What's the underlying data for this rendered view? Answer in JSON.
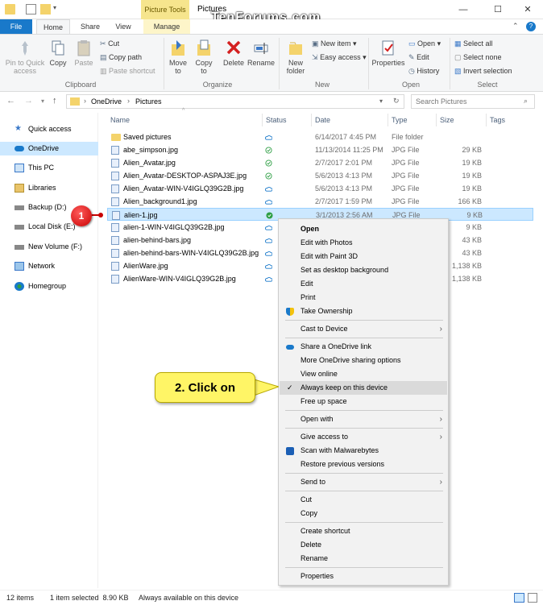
{
  "window": {
    "title": "Pictures",
    "contextual_tab_group": "Picture Tools",
    "watermark": "TenForums.com"
  },
  "tabs": [
    "File",
    "Home",
    "Share",
    "View",
    "Manage"
  ],
  "ribbon": {
    "clipboard": {
      "pin": "Pin to Quick access",
      "copy": "Copy",
      "paste": "Paste",
      "cut": "Cut",
      "copy_path": "Copy path",
      "paste_shortcut": "Paste shortcut",
      "group": "Clipboard"
    },
    "organize": {
      "move_to": "Move to",
      "copy_to": "Copy to",
      "delete": "Delete",
      "rename": "Rename",
      "group": "Organize"
    },
    "new": {
      "new_folder": "New folder",
      "new_item": "New item",
      "easy_access": "Easy access",
      "group": "New"
    },
    "open": {
      "properties": "Properties",
      "open": "Open",
      "edit": "Edit",
      "history": "History",
      "group": "Open"
    },
    "select": {
      "select_all": "Select all",
      "select_none": "Select none",
      "invert": "Invert selection",
      "group": "Select"
    }
  },
  "address": {
    "crumbs": [
      "OneDrive",
      "Pictures"
    ],
    "search_placeholder": "Search Pictures"
  },
  "nav": [
    {
      "label": "Quick access",
      "selected": false
    },
    {
      "label": "OneDrive",
      "selected": true
    },
    {
      "label": "This PC",
      "selected": false
    },
    {
      "label": "Libraries",
      "selected": false
    },
    {
      "label": "Backup (D:)",
      "selected": false
    },
    {
      "label": "Local Disk (E:)",
      "selected": false
    },
    {
      "label": "New Volume (F:)",
      "selected": false
    },
    {
      "label": "Network",
      "selected": false
    },
    {
      "label": "Homegroup",
      "selected": false
    }
  ],
  "columns": {
    "name": "Name",
    "status": "Status",
    "date": "Date",
    "type": "Type",
    "size": "Size",
    "tags": "Tags"
  },
  "files": [
    {
      "name": "Saved pictures",
      "status": "cloud",
      "date": "6/14/2017 4:45 PM",
      "type": "File folder",
      "size": "",
      "folder": true
    },
    {
      "name": "abe_simpson.jpg",
      "status": "check",
      "date": "11/13/2014 11:25 PM",
      "type": "JPG File",
      "size": "29 KB"
    },
    {
      "name": "Alien_Avatar.jpg",
      "status": "check",
      "date": "2/7/2017 2:01 PM",
      "type": "JPG File",
      "size": "19 KB"
    },
    {
      "name": "Alien_Avatar-DESKTOP-ASPAJ3E.jpg",
      "status": "check",
      "date": "5/6/2013 4:13 PM",
      "type": "JPG File",
      "size": "19 KB"
    },
    {
      "name": "Alien_Avatar-WIN-V4IGLQ39G2B.jpg",
      "status": "cloud",
      "date": "5/6/2013 4:13 PM",
      "type": "JPG File",
      "size": "19 KB"
    },
    {
      "name": "Alien_background1.jpg",
      "status": "cloud",
      "date": "2/7/2017 1:59 PM",
      "type": "JPG File",
      "size": "166 KB"
    },
    {
      "name": "alien-1.jpg",
      "status": "solid",
      "date": "3/1/2013 2:56 AM",
      "type": "JPG File",
      "size": "9 KB",
      "selected": true
    },
    {
      "name": "alien-1-WIN-V4IGLQ39G2B.jpg",
      "status": "cloud",
      "date": "",
      "type": "",
      "size": "9 KB"
    },
    {
      "name": "alien-behind-bars.jpg",
      "status": "cloud",
      "date": "",
      "type": "",
      "size": "43 KB"
    },
    {
      "name": "alien-behind-bars-WIN-V4IGLQ39G2B.jpg",
      "status": "cloud",
      "date": "",
      "type": "",
      "size": "43 KB"
    },
    {
      "name": "AlienWare.jpg",
      "status": "cloud",
      "date": "",
      "type": "",
      "size": "1,138 KB"
    },
    {
      "name": "AlienWare-WIN-V4IGLQ39G2B.jpg",
      "status": "cloud",
      "date": "",
      "type": "",
      "size": "1,138 KB"
    }
  ],
  "menu": [
    {
      "label": "Open",
      "bold": true
    },
    {
      "label": "Edit with Photos"
    },
    {
      "label": "Edit with Paint 3D"
    },
    {
      "label": "Set as desktop background"
    },
    {
      "label": "Edit"
    },
    {
      "label": "Print"
    },
    {
      "label": "Take Ownership",
      "icon": "shield-icon"
    },
    {
      "sep": true
    },
    {
      "label": "Cast to Device",
      "arrow": true
    },
    {
      "sep": true
    },
    {
      "label": "Share a OneDrive link",
      "icon": "onedrive-cloud-icon"
    },
    {
      "label": "More OneDrive sharing options"
    },
    {
      "label": "View online"
    },
    {
      "label": "Always keep on this device",
      "check": true,
      "highlight": true
    },
    {
      "label": "Free up space"
    },
    {
      "sep": true
    },
    {
      "label": "Open with",
      "arrow": true
    },
    {
      "sep": true
    },
    {
      "label": "Give access to",
      "arrow": true
    },
    {
      "label": "Scan with Malwarebytes",
      "icon": "malwarebytes-icon"
    },
    {
      "label": "Restore previous versions"
    },
    {
      "sep": true
    },
    {
      "label": "Send to",
      "arrow": true
    },
    {
      "sep": true
    },
    {
      "label": "Cut"
    },
    {
      "label": "Copy"
    },
    {
      "sep": true
    },
    {
      "label": "Create shortcut"
    },
    {
      "label": "Delete"
    },
    {
      "label": "Rename"
    },
    {
      "sep": true
    },
    {
      "label": "Properties"
    }
  ],
  "callouts": {
    "step1": "1",
    "step2": "2. Click on"
  },
  "status": {
    "items": "12 items",
    "selected": "1 item selected  8.90 KB",
    "availability": "Always available on this device"
  },
  "colors": {
    "accent": "#1979ca",
    "selection": "#cce8ff",
    "callout": "#fff566",
    "badge": "#e00000"
  }
}
